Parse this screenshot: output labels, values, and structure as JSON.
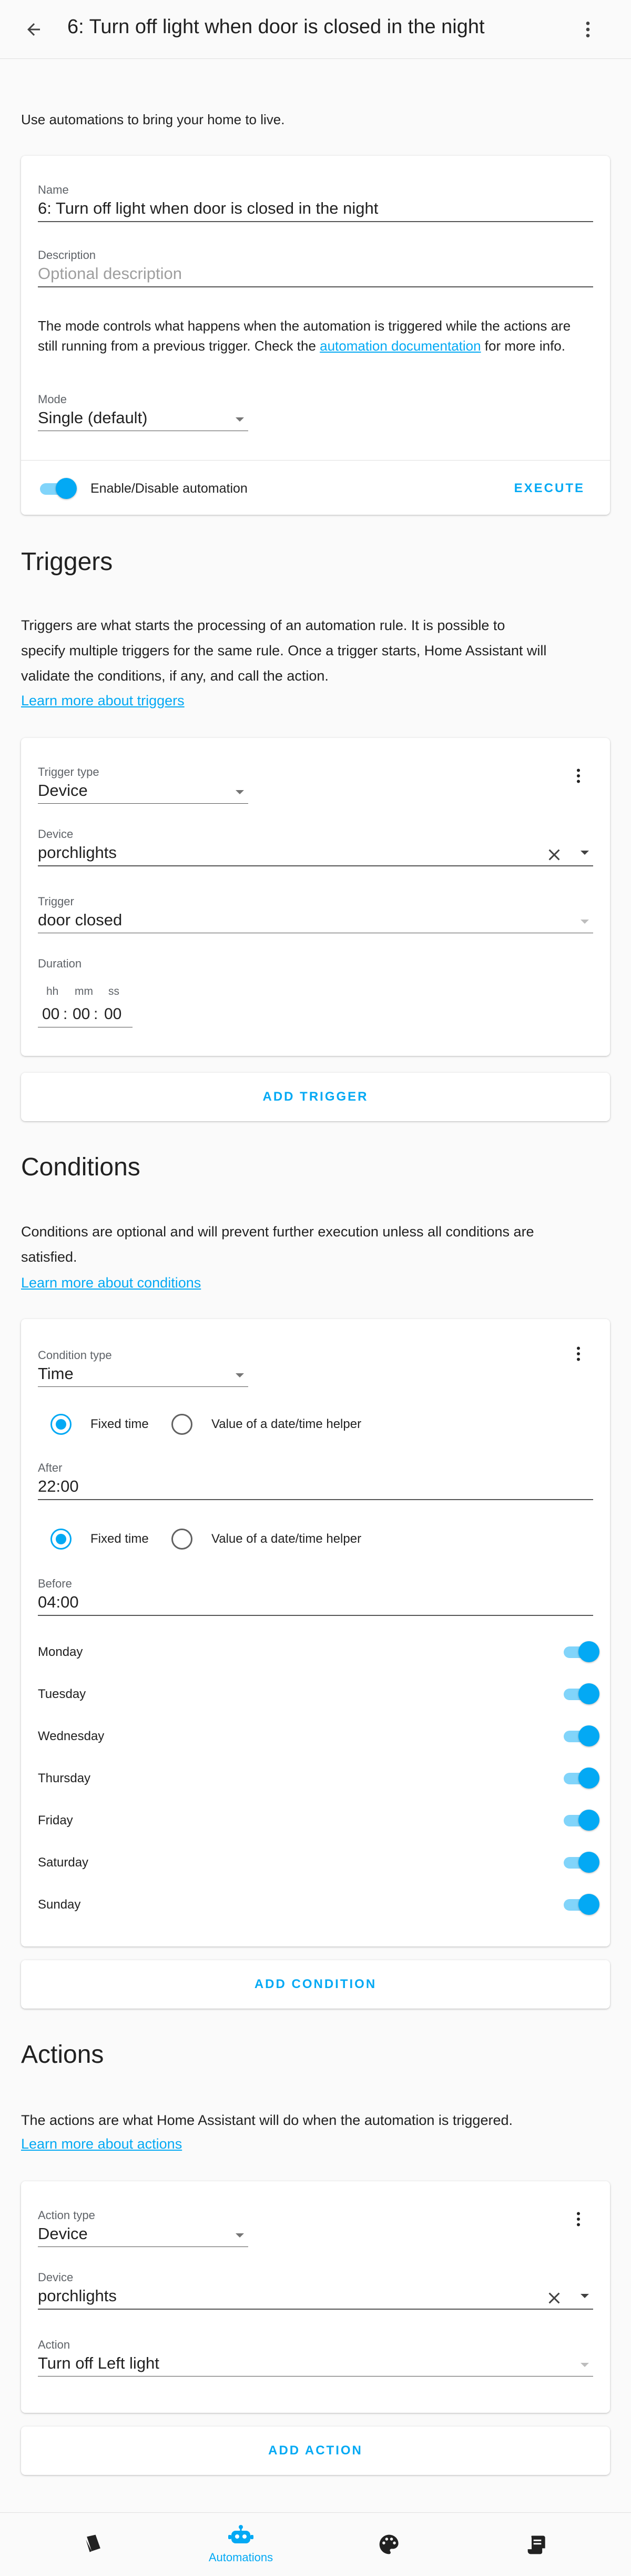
{
  "header": {
    "title": "6: Turn off light when door is closed in the night"
  },
  "intro": "Use automations to bring your home to live.",
  "details": {
    "name_label": "Name",
    "name_value": "6: Turn off light when door is closed in the night",
    "description_label": "Description",
    "description_placeholder": "Optional description",
    "mode_text_before": "The mode controls what happens when the automation is triggered while the actions are still running from a previous trigger. Check the ",
    "mode_link": "automation documentation",
    "mode_text_after": " for more info.",
    "mode_label": "Mode",
    "mode_value": "Single (default)",
    "enable_label": "Enable/Disable automation",
    "execute_label": "EXECUTE"
  },
  "triggers": {
    "title": "Triggers",
    "description": "Triggers are what starts the processing of an automation rule. It is possible to specify multiple triggers for the same rule. Once a trigger starts, Home Assistant will validate the conditions, if any, and call the action.",
    "learn_more": "Learn more about triggers",
    "type_label": "Trigger type",
    "type_value": "Device",
    "device_label": "Device",
    "device_value": "porchlights",
    "trigger_label": "Trigger",
    "trigger_value": "door closed",
    "duration_label": "Duration",
    "duration_units": {
      "hh": "hh",
      "mm": "mm",
      "ss": "ss"
    },
    "duration_values": {
      "hh": "00",
      "mm": "00",
      "ss": "00"
    },
    "add_button": "ADD TRIGGER"
  },
  "conditions": {
    "title": "Conditions",
    "description": "Conditions are optional and will prevent further execution unless all conditions are satisfied.",
    "learn_more": "Learn more about conditions",
    "type_label": "Condition type",
    "type_value": "Time",
    "radio_fixed": "Fixed time",
    "radio_helper": "Value of a date/time helper",
    "after_label": "After",
    "after_value": "22:00",
    "before_label": "Before",
    "before_value": "04:00",
    "days": [
      {
        "label": "Monday",
        "enabled": true
      },
      {
        "label": "Tuesday",
        "enabled": true
      },
      {
        "label": "Wednesday",
        "enabled": true
      },
      {
        "label": "Thursday",
        "enabled": true
      },
      {
        "label": "Friday",
        "enabled": true
      },
      {
        "label": "Saturday",
        "enabled": true
      },
      {
        "label": "Sunday",
        "enabled": true
      }
    ],
    "add_button": "ADD CONDITION"
  },
  "actions": {
    "title": "Actions",
    "description": "The actions are what Home Assistant will do when the automation is triggered.",
    "learn_more": "Learn more about actions",
    "type_label": "Action type",
    "type_value": "Device",
    "device_label": "Device",
    "device_value": "porchlights",
    "action_label": "Action",
    "action_value": "Turn off Left light",
    "add_button": "ADD ACTION"
  },
  "bottom_nav": {
    "active_label": "Automations"
  },
  "colors": {
    "accent": "#03a9f4",
    "accent_light": "#81d4fa",
    "text": "#212121",
    "background": "#fafafa"
  }
}
